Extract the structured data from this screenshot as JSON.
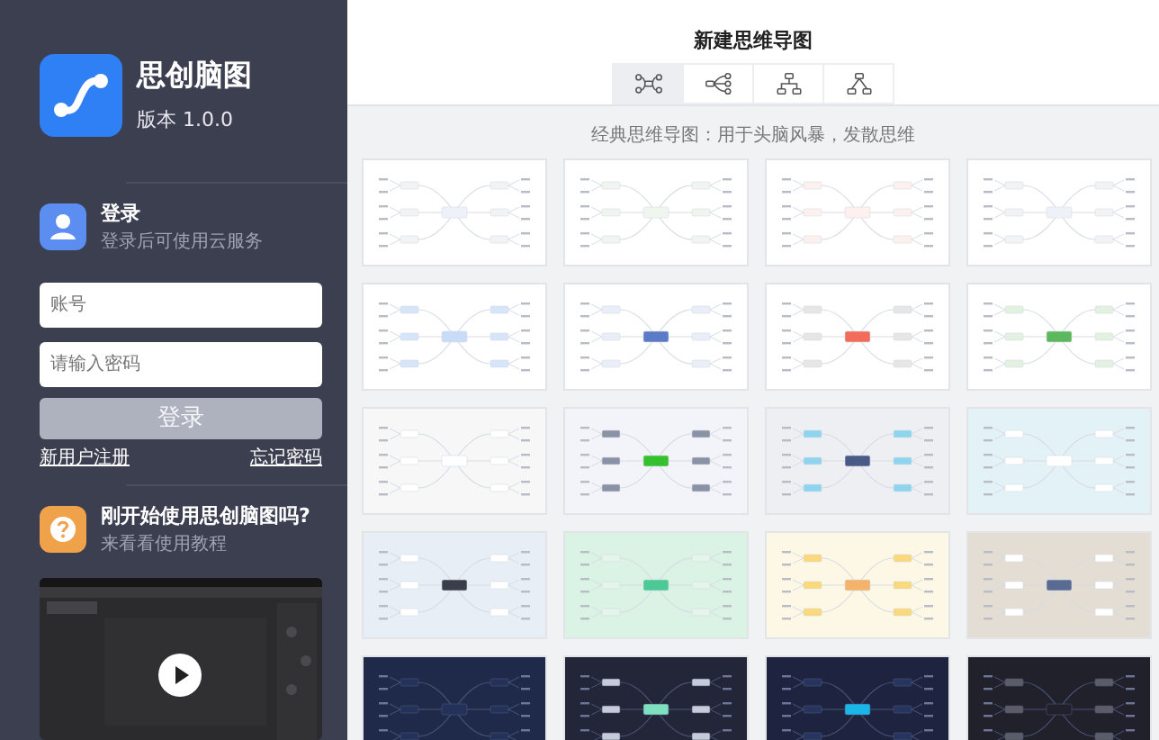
{
  "app": {
    "name": "思创脑图",
    "version": "版本 1.0.0"
  },
  "login": {
    "title": "登录",
    "subtitle": "登录后可使用云服务",
    "account": {
      "placeholder": "账号"
    },
    "password": {
      "placeholder": "请输入密码"
    },
    "button": "登录",
    "button_disabled": true,
    "register_link": "新用户注册",
    "forgot_link": "忘记密码"
  },
  "help": {
    "title": "刚开始使用思创脑图吗?",
    "subtitle": "来看看使用教程"
  },
  "header": {
    "title": "新建思维导图"
  },
  "layout_tabs": [
    {
      "kind": "mindmap",
      "selected": true
    },
    {
      "kind": "right",
      "selected": false
    },
    {
      "kind": "org",
      "selected": false
    },
    {
      "kind": "tree",
      "selected": false
    }
  ],
  "description": "经典思维导图：用于头脑风暴，发散思维",
  "templates": [
    {
      "color": "#ffffff",
      "center": {
        "color": "#eef2f8"
      },
      "node": {
        "color": "#f2f3f5"
      }
    },
    {
      "color": "#ffffff",
      "center": {
        "color": "#eef6ee"
      },
      "node": {
        "color": "#f0f6ef"
      }
    },
    {
      "color": "#ffffff",
      "center": {
        "color": "#fdf0ee"
      },
      "node": {
        "color": "#fdf1ef"
      }
    },
    {
      "color": "#ffffff",
      "center": {
        "color": "#eef2f8"
      },
      "node": {
        "color": "#f2f3f5"
      }
    },
    {
      "color": "#ffffff",
      "center": {
        "color": "#c9dcf7"
      },
      "node": {
        "color": "#d6e5fa"
      }
    },
    {
      "color": "#ffffff",
      "center": {
        "color": "#5b7bc9"
      },
      "node": {
        "color": "#e9eef8"
      }
    },
    {
      "color": "#ffffff",
      "center": {
        "color": "#f26b5b"
      },
      "node": {
        "color": "#e6e6e6"
      }
    },
    {
      "color": "#ffffff",
      "center": {
        "color": "#5cb85c"
      },
      "node": {
        "color": "#e3f1e1"
      }
    },
    {
      "color": "#f7f7f7",
      "center": {
        "color": "#ffffff"
      },
      "node": {
        "color": "#ffffff"
      }
    },
    {
      "color": "#f3f4f9",
      "center": {
        "color": "#35c12e"
      },
      "node": {
        "color": "#8a93a5"
      }
    },
    {
      "color": "#eeeff3",
      "center": {
        "color": "#4a5a86"
      },
      "node": {
        "color": "#8fd4ee"
      }
    },
    {
      "color": "#e3f2f7",
      "center": {
        "color": "#ffffff"
      },
      "node": {
        "color": "#ffffff"
      }
    },
    {
      "color": "#e8eef5",
      "center": {
        "color": "#3a3d4a"
      },
      "node": {
        "color": "#ffffff"
      }
    },
    {
      "color": "#dbf3e4",
      "center": {
        "color": "#4cc995"
      },
      "node": {
        "color": "#e4f5ea"
      }
    },
    {
      "color": "#fdf8e6",
      "center": {
        "color": "#f4b26a"
      },
      "node": {
        "color": "#fbd97a"
      }
    },
    {
      "color": "#e4ddd3",
      "center": {
        "color": "#596a93"
      },
      "node": {
        "color": "#ffffff"
      }
    },
    {
      "color": "#1f2a4b",
      "center": {
        "color": "#24325a"
      },
      "node": {
        "color": "#24325a"
      }
    },
    {
      "color": "#232638",
      "center": {
        "color": "#7fe0c0"
      },
      "node": {
        "color": "#c7cbd8"
      }
    },
    {
      "color": "#1e2440",
      "center": {
        "color": "#1ab6e8"
      },
      "node": {
        "color": "#27355e"
      }
    },
    {
      "color": "#20212b",
      "center": {
        "color": "#20212b"
      },
      "node": {
        "color": "#5a5c66"
      }
    }
  ]
}
